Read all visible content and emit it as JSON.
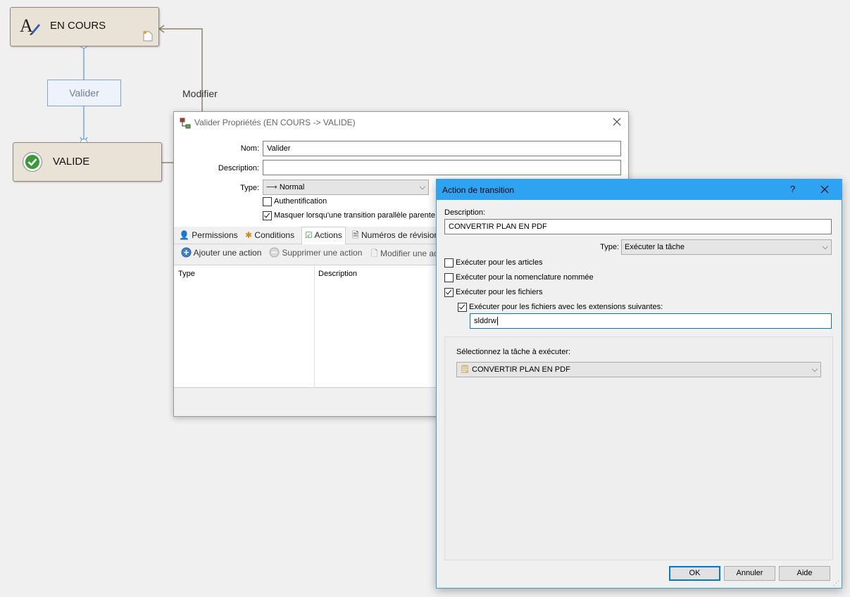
{
  "canvas": {
    "state_en_cours": "EN COURS",
    "state_valide": "VALIDE",
    "transition_valider": "Valider",
    "transition_modifier": "Modifier"
  },
  "props_dialog": {
    "title": "Valider Propriétés (EN COURS -> VALIDE)",
    "nom_label": "Nom:",
    "nom_value": "Valider",
    "description_label": "Description:",
    "description_value": "",
    "type_label": "Type:",
    "type_value": "Normal",
    "auth_label": "Authentification",
    "auth_checked": false,
    "masquer_label": "Masquer lorsqu'une transition parallèle parente e",
    "masquer_checked": true,
    "tabs": [
      "Permissions",
      "Conditions",
      "Actions",
      "Numéros de révision"
    ],
    "active_tab": "Actions",
    "toolbar": {
      "add": "Ajouter une action",
      "remove": "Supprimer une action",
      "modify": "Modifier une ac"
    },
    "columns": [
      "Type",
      "Description"
    ]
  },
  "action_dialog": {
    "title": "Action de transition",
    "help": "?",
    "description_label": "Description:",
    "description_value": "CONVERTIR PLAN EN PDF",
    "type_label": "Type:",
    "type_value": "Exécuter la tâche",
    "checks": {
      "articles": {
        "label": "Exécuter pour les articles",
        "checked": false
      },
      "nomenclature": {
        "label": "Exécuter pour la nomenclature nommée",
        "checked": false
      },
      "fichiers": {
        "label": "Exécuter pour les fichiers",
        "checked": true
      },
      "extensions": {
        "label": "Exécuter pour les fichiers avec les extensions suivantes:",
        "checked": true
      }
    },
    "extensions_value": "slddrw",
    "task_label": "Sélectionnez la tâche à exécuter:",
    "task_value": "CONVERTIR PLAN EN PDF",
    "buttons": {
      "ok": "OK",
      "cancel": "Annuler",
      "help": "Aide"
    },
    "accent": "#2ea3f2"
  }
}
